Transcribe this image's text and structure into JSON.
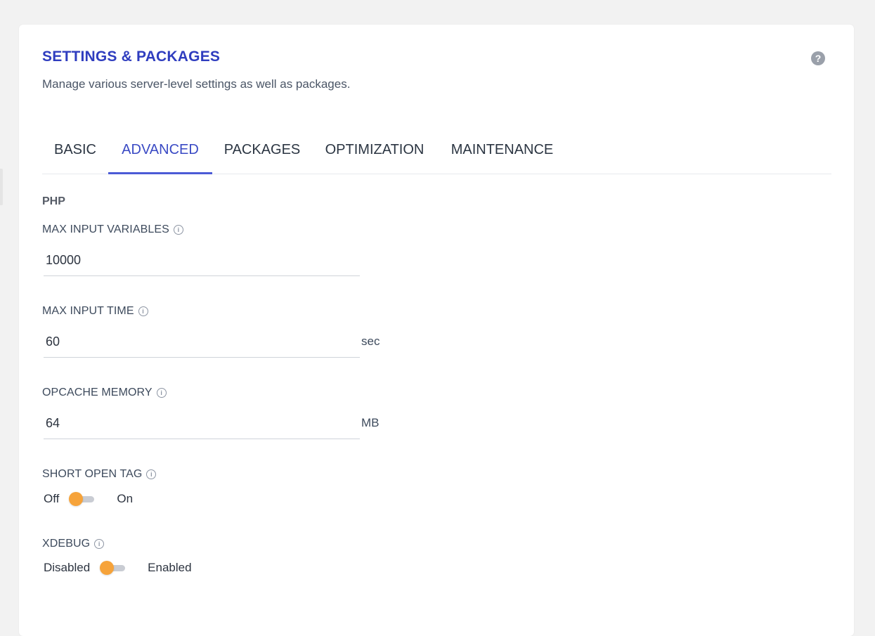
{
  "colors": {
    "title": "#2f3dbf",
    "active_tab": "#3a4ac4",
    "toggle_knob": "#f6a33a",
    "toggle_track": "#c9ccd3"
  },
  "header": {
    "title": "SETTINGS & PACKAGES",
    "subtitle": "Manage various server-level settings as well as packages.",
    "help_icon": "question-circle-icon"
  },
  "tabs": [
    {
      "label": "BASIC",
      "active": false
    },
    {
      "label": "ADVANCED",
      "active": true
    },
    {
      "label": "PACKAGES",
      "active": false
    },
    {
      "label": "OPTIMIZATION",
      "active": false
    },
    {
      "label": "MAINTENANCE",
      "active": false
    }
  ],
  "php": {
    "section_title": "PHP",
    "max_input_variables": {
      "label": "MAX INPUT VARIABLES",
      "value": "10000",
      "info_icon": "info-circle-icon"
    },
    "max_input_time": {
      "label": "MAX INPUT TIME",
      "value": "60",
      "unit": "sec",
      "info_icon": "info-circle-icon"
    },
    "opcache_memory": {
      "label": "OPCACHE MEMORY",
      "value": "64",
      "unit": "MB",
      "info_icon": "info-circle-icon"
    },
    "short_open_tag": {
      "label": "SHORT OPEN TAG",
      "off_label": "Off",
      "on_label": "On",
      "state": "off",
      "info_icon": "info-circle-icon"
    },
    "xdebug": {
      "label": "XDEBUG",
      "off_label": "Disabled",
      "on_label": "Enabled",
      "state": "off",
      "info_icon": "info-circle-icon"
    }
  }
}
